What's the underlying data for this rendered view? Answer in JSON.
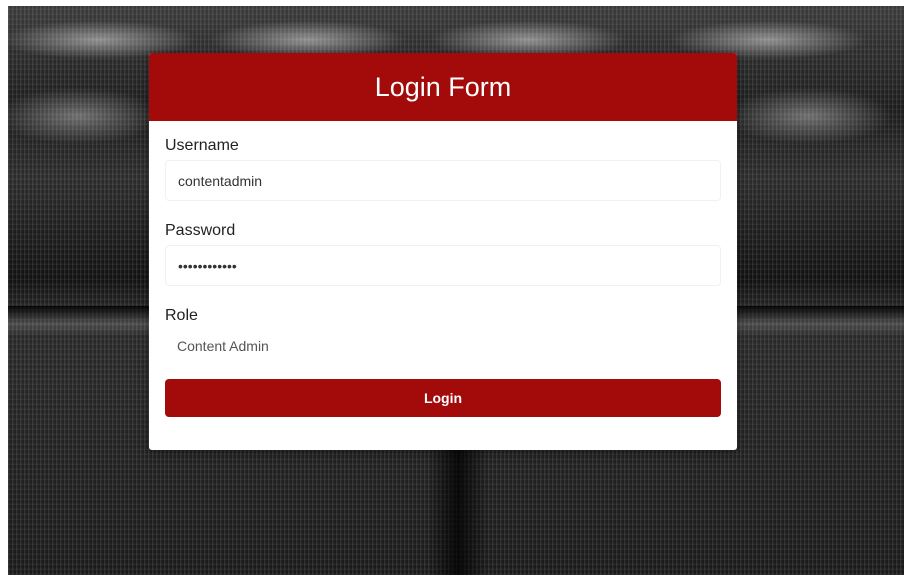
{
  "form": {
    "title": "Login Form",
    "username": {
      "label": "Username",
      "value": "contentadmin"
    },
    "password": {
      "label": "Password",
      "value": "••••••••••••"
    },
    "role": {
      "label": "Role",
      "selected": "Content Admin"
    },
    "submit_label": "Login"
  },
  "colors": {
    "accent": "#a30b0b"
  }
}
